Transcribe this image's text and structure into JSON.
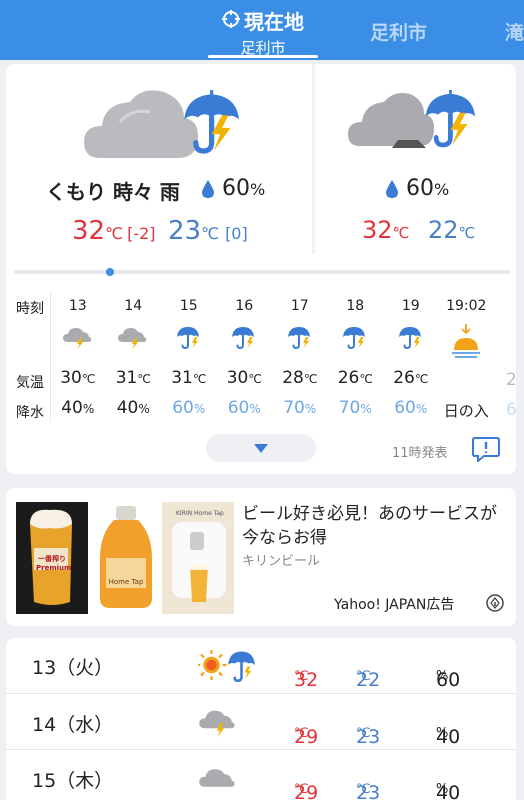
{
  "header": {
    "current_tab_title": "現在地",
    "current_tab_sub": "足利市",
    "other_tab": "足利市",
    "edge_tab": "滝"
  },
  "today": {
    "condition": "くもり 時々 雨",
    "precip": "60",
    "precip_unit": "%",
    "high": "32",
    "high_diff": "[-2]",
    "low": "23",
    "low_diff": "[0]",
    "unit": "℃"
  },
  "tomorrow": {
    "precip": "60",
    "precip_unit": "%",
    "high": "32",
    "low": "22",
    "unit": "℃"
  },
  "hourly": {
    "labels": {
      "time": "時刻",
      "temp": "気温",
      "rain": "降水"
    },
    "hours": [
      {
        "time": "13",
        "icon": "cloud-thunder-icon",
        "temp": "30",
        "rain": "40"
      },
      {
        "time": "14",
        "icon": "cloud-thunder-icon",
        "temp": "31",
        "rain": "40"
      },
      {
        "time": "15",
        "icon": "umbrella-thunder-icon",
        "temp": "31",
        "rain": "60"
      },
      {
        "time": "16",
        "icon": "umbrella-thunder-icon",
        "temp": "30",
        "rain": "60"
      },
      {
        "time": "17",
        "icon": "umbrella-thunder-icon",
        "temp": "28",
        "rain": "70"
      },
      {
        "time": "18",
        "icon": "umbrella-thunder-icon",
        "temp": "26",
        "rain": "70"
      },
      {
        "time": "19",
        "icon": "umbrella-thunder-icon",
        "temp": "26",
        "rain": "60"
      }
    ],
    "sunset": {
      "time": "19:02",
      "label": "日の入"
    },
    "temp_unit": "℃",
    "rain_unit": "%",
    "partial_temp": "2",
    "partial_rain": "6",
    "published": "11時発表"
  },
  "ad": {
    "headline": "ビール好き必見！あのサービスが今ならお得",
    "sponsor": "キリンビール",
    "label": "Yahoo! JAPAN広告",
    "info_icon": "info-icon",
    "img1_text": "一番搾り Premium",
    "img2_text": "Home Tap",
    "img3_text": "KIRIN Home Tap"
  },
  "daily": [
    {
      "day": "13（火）",
      "icon": "sun-umbrella-icon",
      "high": "32",
      "low": "22",
      "precip": "60"
    },
    {
      "day": "14（水）",
      "icon": "cloud-thunder-icon",
      "high": "29",
      "low": "23",
      "precip": "40"
    },
    {
      "day": "15（木）",
      "icon": "cloud-icon",
      "high": "29",
      "low": "23",
      "precip": "40"
    }
  ],
  "daily_unit": {
    "temp": "℃",
    "precip": "%"
  },
  "colors": {
    "header": "#3a8ee6",
    "high": "#e0353a",
    "low": "#4a7fc8",
    "rain_high": "#6fa7e6"
  }
}
